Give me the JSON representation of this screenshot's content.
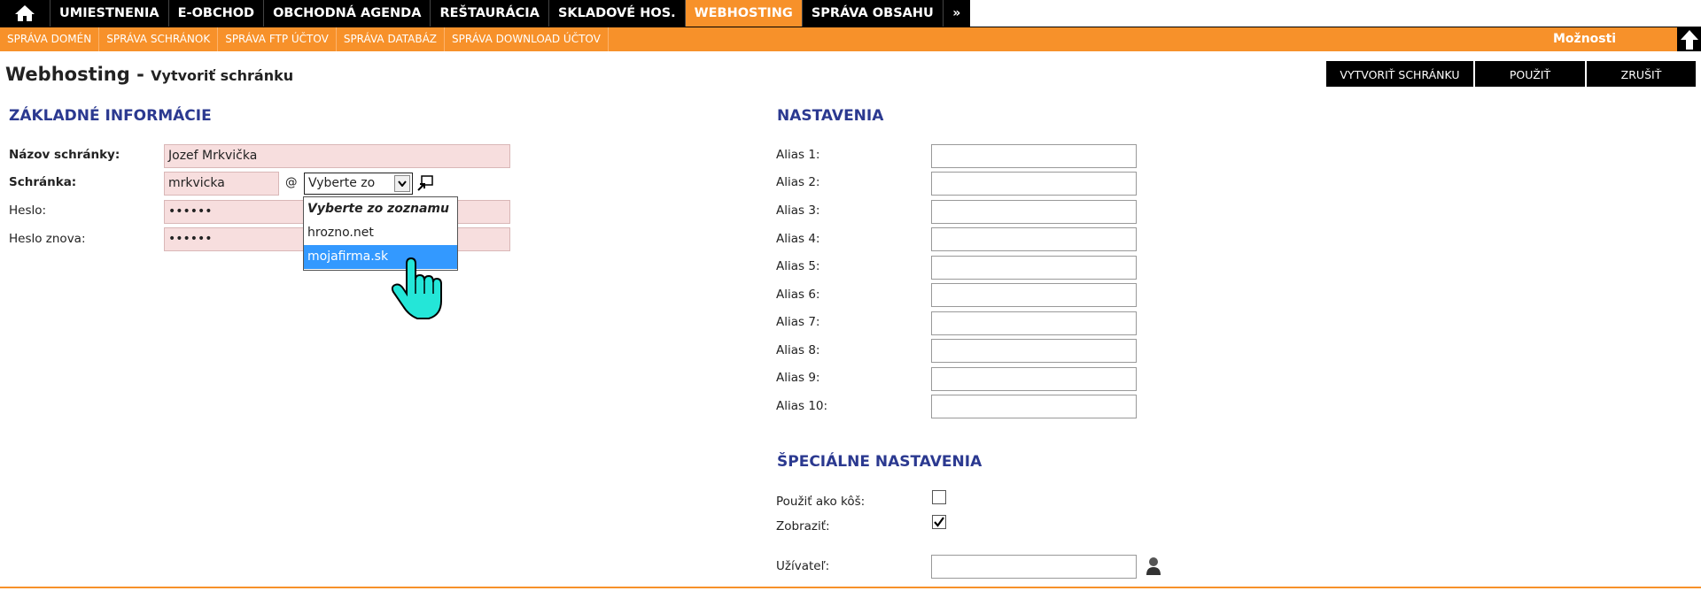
{
  "topnav": {
    "items": [
      "UMIESTNENIA",
      "E-OBCHOD",
      "OBCHODNÁ AGENDA",
      "REŠTAURÁCIA",
      "SKLADOVÉ HOS.",
      "WEBHOSTING",
      "SPRÁVA OBSAHU"
    ],
    "more": "»",
    "active": "WEBHOSTING"
  },
  "subnav": {
    "items": [
      "SPRÁVA DOMÉN",
      "SPRÁVA SCHRÁNOK",
      "SPRÁVA FTP ÚČTOV",
      "SPRÁVA DATABÁZ",
      "SPRÁVA DOWNLOAD ÚČTOV"
    ],
    "options": "Možnosti"
  },
  "page": {
    "title": "Webhosting -",
    "subtitle": "Vytvoriť schránku"
  },
  "buttons": {
    "create": "VYTVORIŤ SCHRÁNKU",
    "apply": "POUŽIŤ",
    "cancel": "ZRUŠIŤ"
  },
  "basic": {
    "heading": "ZÁKLADNÉ INFORMÁCIE",
    "name_label": "Názov schránky:",
    "name_value": "Jozef Mrkvička",
    "mailbox_label": "Schránka:",
    "mailbox_value": "mrkvicka",
    "at": "@",
    "domain_selected": "Vyberte zo zoznamu",
    "domain_options": [
      "Vyberte zo zoznamu",
      "hrozno.net",
      "mojafirma.sk"
    ],
    "password_label": "Heslo:",
    "password_value": "••••••",
    "password2_label": "Heslo znova:",
    "password2_value": "••••••"
  },
  "settings": {
    "heading": "NASTAVENIA",
    "aliases": [
      "Alias 1:",
      "Alias 2:",
      "Alias 3:",
      "Alias 4:",
      "Alias 5:",
      "Alias 6:",
      "Alias 7:",
      "Alias 8:",
      "Alias 9:",
      "Alias 10:"
    ]
  },
  "special": {
    "heading": "ŠPECIÁLNE NASTAVENIA",
    "trash_label": "Použiť ako kôš:",
    "trash_checked": false,
    "show_label": "Zobraziť:",
    "show_checked": true,
    "user_label": "Užívateľ:",
    "user_value": ""
  },
  "colors": {
    "accent": "#f7912a",
    "heading": "#2b3990",
    "selected": "#3399ff"
  }
}
